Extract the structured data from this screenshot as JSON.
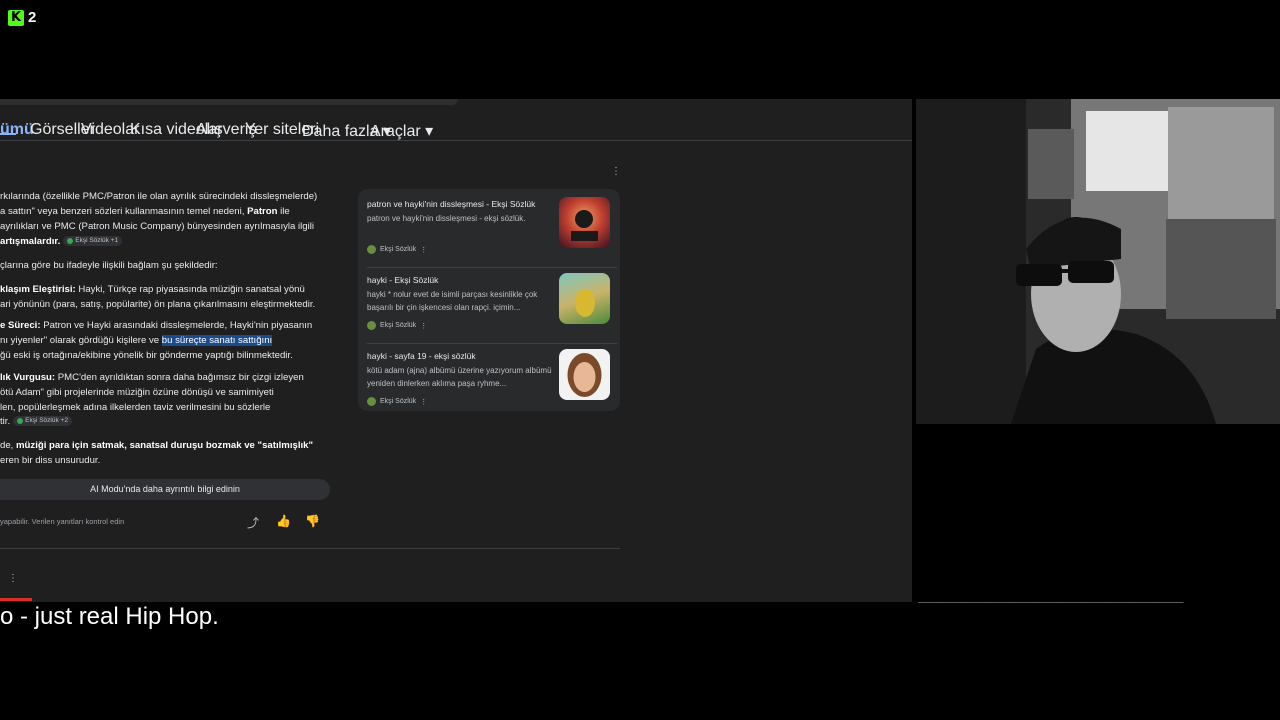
{
  "overlay": {
    "badge_letter": "K",
    "badge_count": "2"
  },
  "tabs": [
    {
      "label": "ümü",
      "active": true
    },
    {
      "label": "Görseller"
    },
    {
      "label": "Videolar"
    },
    {
      "label": "Kısa videolar"
    },
    {
      "label": "Alışveriş"
    },
    {
      "label": "Yer siteleri"
    },
    {
      "label": "Daha fazla"
    },
    {
      "label": "Araçlar"
    }
  ],
  "ai_overview": {
    "lines": [
      "rkılarında (özellikle PMC/Patron ile olan ayrılık sürecindeki dissleşmelerde)",
      "a sattın\" veya benzeri sözleri kullanmasının temel nedeni, ",
      "Patron",
      " ile",
      " ayrılıkları ve PMC (Patron Music Company) bünyesinden ayrılmasıyla ilgili",
      "artışmalardır.",
      "çlarına göre bu ifadeyle ilişkili bağlam şu şekildedir:",
      "klaşım Eleştirisi:",
      " Hayki, Türkçe rap piyasasında müziğin sanatsal yönü",
      "ari yönünün (para, satış, popülarite) ön plana çıkarılmasını eleştirmektedir.",
      "e Süreci:",
      " Patron ve Hayki arasındaki dissleşmelerde, Hayki'nin piyasanın",
      "nı yiyenler\" olarak gördüğü kişilere ve ",
      "bu süreçte sanatı sattığını",
      "ğü eski iş ortağına/ekibine yönelik bir gönderme yaptığı bilinmektedir.",
      "lık Vurgusu:",
      " PMC'den ayrıldıktan sonra daha bağımsız bir çizgi izleyen",
      "ötü Adam\" gibi projelerinde müziğin özüne dönüşü ve samimiyeti",
      "len, popülerleşmek adına ilkelerden taviz verilmesini bu sözlerle",
      "tir.",
      "de, ",
      "müziği para için satmak, sanatsal duruşu bozmak ve \"satılmışlık\"",
      "eren bir diss unsurudur."
    ],
    "chips": [
      "Ekşi Sözlük +1",
      "Ekşi Sözlük +2"
    ],
    "more_button": "AI Modu'nda daha ayrıntılı bilgi edinin",
    "footer_note": "yapabilir. Verilen yanıtları kontrol edin"
  },
  "sources": [
    {
      "title": "patron ve hayki'nin dissleşmesi - Ekşi Sözlük",
      "snippet": "patron ve hayki'nin dissleşmesi - ekşi sözlük.",
      "site": "Ekşi Sözlük"
    },
    {
      "title": "hayki - Ekşi Sözlük",
      "snippet": "hayki * nolur evet de isimli parçası kesinlikle çok başarılı bir çin işkencesi olan rapçi. içimin...",
      "site": "Ekşi Sözlük"
    },
    {
      "title": "hayki - sayfa 19 - ekşi sözlük",
      "snippet": "kötü adam (ajna) albümü üzerine yazıyorum albümü yeniden dinlerken aklıma paşa ryhme...",
      "site": "Ekşi Sözlük"
    }
  ],
  "caption": "o - just real Hip Hop.",
  "underscore_line": "____________________________________________"
}
